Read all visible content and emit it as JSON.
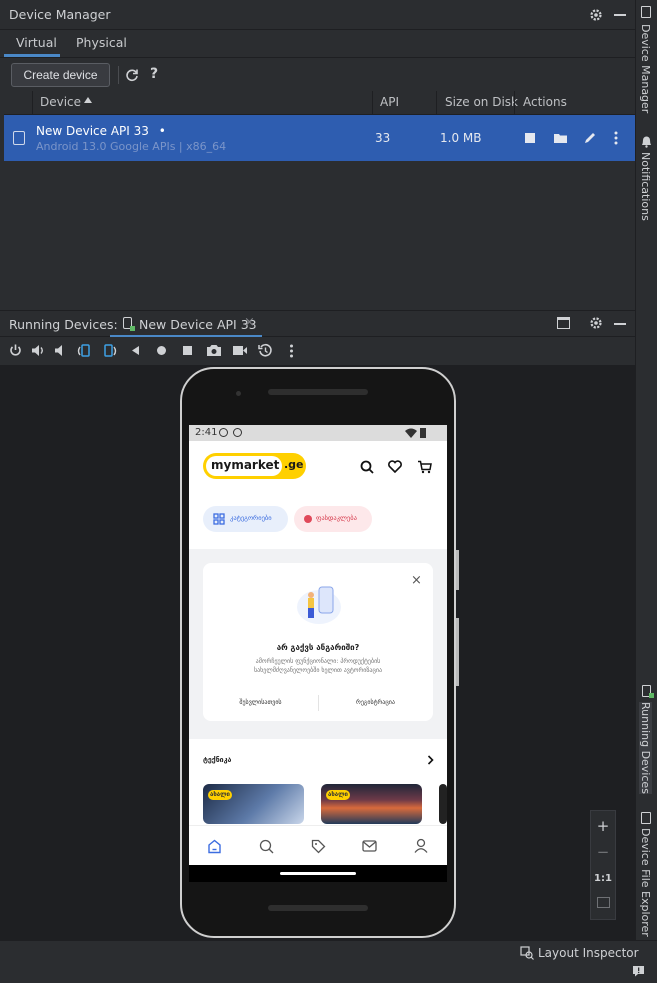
{
  "device_manager": {
    "title": "Device Manager",
    "tabs": [
      "Virtual",
      "Physical"
    ],
    "create_button": "Create device",
    "columns": [
      "Device",
      "API",
      "Size on Disk",
      "Actions"
    ],
    "rows": [
      {
        "name": "New Device API 33",
        "status_dot": "•",
        "subtitle": "Android 13.0 Google APIs | x86_64",
        "api": "33",
        "size": "1.0 MB"
      }
    ]
  },
  "running_devices": {
    "label": "Running Devices:",
    "tab_label": "New Device API 33",
    "zoom_ratio": "1:1"
  },
  "side_strip": {
    "items": [
      "Device Manager",
      "Notifications",
      "Running Devices",
      "Device File Explorer"
    ]
  },
  "status_bar": {
    "layout_inspector": "Layout Inspector"
  },
  "phone": {
    "time": "2:41",
    "logo_text": "mymarket",
    "logo_domain": ".ge",
    "chips": [
      "კატეგორიები",
      "ფასდაკლება"
    ],
    "card": {
      "title": "არ გაქვს ანგარიში?",
      "body_line1": "ამორჩეულის ფუნქციონალი: პროდუქტების",
      "body_line2": "სახელმძღვანელოებში ხელით ავტორიზაცია",
      "action_left": "შესვლისათვის",
      "action_right": "რეგისტრაცია"
    },
    "section_title": "ტექნიკა",
    "badges": [
      "ახალი",
      "ახალი"
    ],
    "nav_icons": [
      "home-icon",
      "search-icon",
      "tag-icon",
      "mail-icon",
      "profile-icon"
    ]
  },
  "colors": {
    "accent": "#4a88c7",
    "selected_row": "#2e5db0",
    "brand_yellow": "#ffd000"
  }
}
